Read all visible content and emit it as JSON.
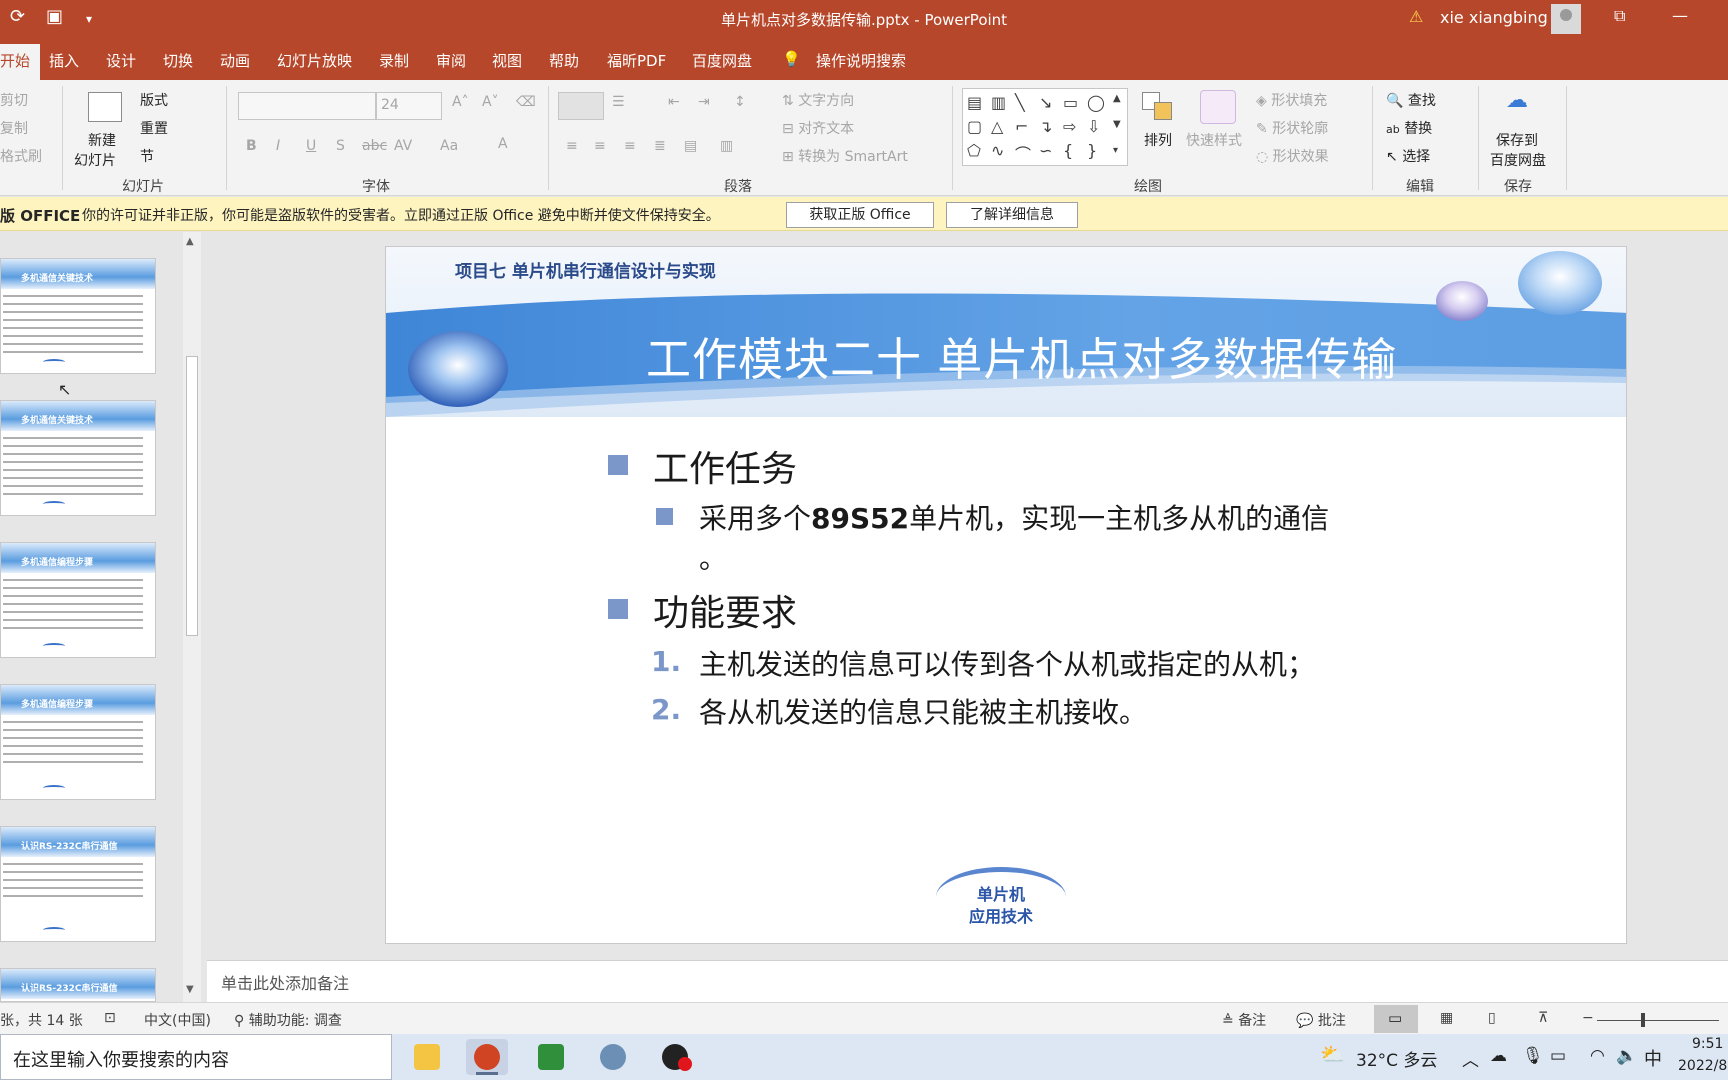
{
  "titlebar": {
    "doc_title": "单片机点对多数据传输.pptx  -  PowerPoint",
    "user": "xie xiangbing",
    "warn_icon": "warning-icon"
  },
  "tabs": [
    "开始",
    "插入",
    "设计",
    "切换",
    "动画",
    "幻灯片放映",
    "录制",
    "审阅",
    "视图",
    "帮助",
    "福昕PDF",
    "百度网盘"
  ],
  "tell_me": "操作说明搜索",
  "ribbon": {
    "clipboard": {
      "cut": "剪切",
      "copy": "复制",
      "format_painter": "格式刷"
    },
    "slides": {
      "new_slide_1": "新建",
      "new_slide_2": "幻灯片",
      "layout": "版式",
      "reset": "重置",
      "section": "节",
      "label": "幻灯片"
    },
    "font": {
      "size": "24",
      "label": "字体",
      "buttons": [
        "B",
        "I",
        "U",
        "S",
        "abc",
        "AV",
        "Aa",
        "A"
      ]
    },
    "paragraph": {
      "text_direction": "文字方向",
      "align_text": "对齐文本",
      "smartart": "转换为 SmartArt",
      "label": "段落"
    },
    "drawing": {
      "arrange": "排列",
      "quick_styles": "快速样式",
      "shape_fill": "形状填充",
      "shape_outline": "形状轮廓",
      "shape_effects": "形状效果",
      "label": "绘图"
    },
    "editing": {
      "find": "查找",
      "replace": "替换",
      "select": "选择",
      "label": "编辑"
    },
    "save": {
      "line1": "保存到",
      "line2": "百度网盘",
      "label": "保存"
    }
  },
  "notice": {
    "bold": "版 OFFICE",
    "message": "你的许可证并非正版，你可能是盗版软件的受害者。立即通过正版 Office 避免中断并使文件保持安全。",
    "btn_get": "获取正版 Office",
    "btn_learn": "了解详细信息"
  },
  "thumbnails": [
    {
      "title": "多机通信关键技术"
    },
    {
      "title": "多机通信关键技术"
    },
    {
      "title": "多机通信编程步骤"
    },
    {
      "title": "多机通信编程步骤"
    },
    {
      "title": "认识RS-232C串行通信"
    },
    {
      "title": "认识RS-232C串行通信"
    }
  ],
  "slide": {
    "project": "项目七  单片机串行通信设计与实现",
    "heading": "工作模块二十  单片机点对多数据传输",
    "task_title": "工作任务",
    "task_pre": "采用多个",
    "task_bold": "89S52",
    "task_post": "单片机，实现一主机多从机的通信",
    "task_cont": "。",
    "req_title": "功能要求",
    "req_items": [
      {
        "num": "1.",
        "text": "主机发送的信息可以传到各个从机或指定的从机；"
      },
      {
        "num": "2.",
        "text": "各从机发送的信息只能被主机接收。"
      }
    ],
    "logo_line1": "单片机",
    "logo_line2": "应用技术"
  },
  "notes_placeholder": "单击此处添加备注",
  "status": {
    "slide_count": "张，共 14 张",
    "language": "中文(中国)",
    "accessibility": "辅助功能: 调查",
    "notes": "备注",
    "comments": "批注"
  },
  "taskbar": {
    "search_placeholder": "在这里输入你要搜索的内容",
    "weather": "32°C  多云",
    "ime": "中",
    "time": "9:51",
    "date": "2022/8"
  },
  "colors": {
    "accent": "#b7472a",
    "bullet": "#7b96c9",
    "notice_bg": "#fdf4bf"
  }
}
